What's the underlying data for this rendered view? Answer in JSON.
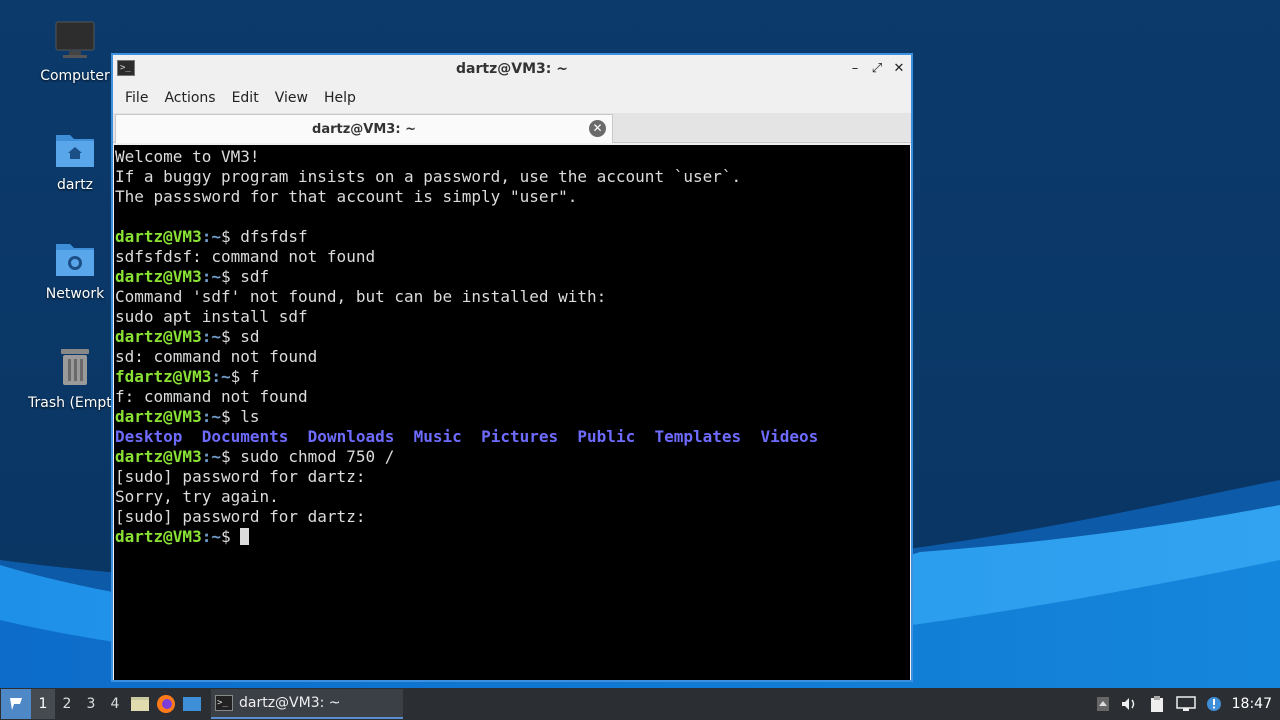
{
  "desktop": {
    "icons": [
      {
        "label": "Computer"
      },
      {
        "label": "dartz"
      },
      {
        "label": "Network"
      },
      {
        "label": "Trash (Empty)"
      }
    ]
  },
  "window": {
    "title": "dartz@VM3: ~",
    "menu": [
      "File",
      "Actions",
      "Edit",
      "View",
      "Help"
    ],
    "tab_label": "dartz@VM3: ~",
    "controls": {
      "minimize": "–",
      "maximize": "⤢",
      "close": "✕"
    }
  },
  "terminal": {
    "prompt_user": "dartz@VM3",
    "prompt_path": ":~",
    "prompt_symbol": "$ ",
    "welcome": [
      "Welcome to VM3!",
      "If a buggy program insists on a password, use the account `user`.",
      "The passsword for that account is simply \"user\"."
    ],
    "session": [
      {
        "type": "cmd",
        "cmd": "dfsfdsf"
      },
      {
        "type": "out",
        "text": "sdfsfdsf: command not found"
      },
      {
        "type": "cmd",
        "cmd": "sdf"
      },
      {
        "type": "out",
        "text": "Command 'sdf' not found, but can be installed with:"
      },
      {
        "type": "out",
        "text": "sudo apt install sdf"
      },
      {
        "type": "cmd",
        "cmd": "sd"
      },
      {
        "type": "out",
        "text": "sd: command not found"
      },
      {
        "type": "cmd",
        "prefix": "f",
        "cmd": "f"
      },
      {
        "type": "out",
        "text": "f: command not found"
      },
      {
        "type": "cmd",
        "cmd": "ls"
      },
      {
        "type": "ls",
        "items": [
          "Desktop",
          "Documents",
          "Downloads",
          "Music",
          "Pictures",
          "Public",
          "Templates",
          "Videos"
        ]
      },
      {
        "type": "cmd",
        "cmd": "sudo chmod 750 /"
      },
      {
        "type": "out",
        "text": "[sudo] password for dartz:"
      },
      {
        "type": "out",
        "text": "Sorry, try again."
      },
      {
        "type": "out",
        "text": "[sudo] password for dartz:"
      },
      {
        "type": "cursor"
      }
    ]
  },
  "taskbar": {
    "workspaces": [
      "1",
      "2",
      "3",
      "4"
    ],
    "active_workspace": "1",
    "task_label": "dartz@VM3: ~",
    "clock": "18:47"
  },
  "colors": {
    "prompt_user": "#8ae234",
    "prompt_path": "#729fcf",
    "dir": "#6e6bff",
    "window_border": "#3d8fe0"
  }
}
